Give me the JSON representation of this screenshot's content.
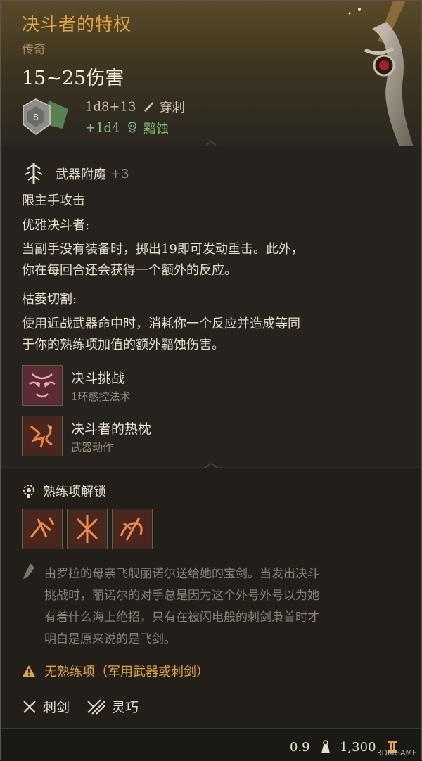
{
  "item": {
    "name": "决斗者的特权",
    "rarity": "传奇",
    "damage": "15~25伤害",
    "dice_label": "8",
    "damage_lines": [
      {
        "value": "1d8+13",
        "type": "穿刺",
        "color": "#cfc5b4"
      },
      {
        "value": "+1d4",
        "type": "黯蚀",
        "color": "#86c07c"
      }
    ]
  },
  "enchant": {
    "label": "武器附魔",
    "bonus": "+3"
  },
  "passives": {
    "main_hand": "限主手攻击",
    "elegant_title": "优雅决斗者:",
    "elegant_line1": "当副手没有装备时，掷出19即可发动重击。此外，",
    "elegant_line2": "你在每回合还会获得一个额外的反应。",
    "wither_title": "枯萎切割:",
    "wither_line1": "使用近战武器命中时，消耗你一个反应并造成等同",
    "wither_line2": "于你的熟练项加值的额外黯蚀伤害。"
  },
  "spells": [
    {
      "name": "决斗挑战",
      "desc": "1环惑控法术",
      "icon": "duel-challenge-icon"
    },
    {
      "name": "决斗者的热枕",
      "desc": "武器动作",
      "icon": "duelist-zeal-icon"
    }
  ],
  "proficiency": {
    "title": "熟练项解锁",
    "actions": [
      "action-icon-1",
      "action-icon-2",
      "action-icon-3"
    ]
  },
  "lore": [
    "由罗拉的母亲飞舰丽诺尔送给她的宝剑。当发出决斗",
    "挑战时，丽诺尔的对手总是因为这个外号外号以为她",
    "有着什么海上绝招，只有在被闪电般的刺剑枭首时才",
    "明白是原来说的是飞剑。"
  ],
  "warning": "无熟练项（军用武器或刺剑）",
  "traits": [
    {
      "label": "刺剑",
      "icon": "rapier-icon"
    },
    {
      "label": "灵巧",
      "icon": "finesse-icon"
    }
  ],
  "footer": {
    "weight": "0.9",
    "price": "1,300"
  },
  "watermark": "3DMGAME",
  "colors": {
    "title": "#e2a24a",
    "rarity": "#a8865a",
    "dark_damage": "#86c07c",
    "warning": "#e0a348"
  }
}
